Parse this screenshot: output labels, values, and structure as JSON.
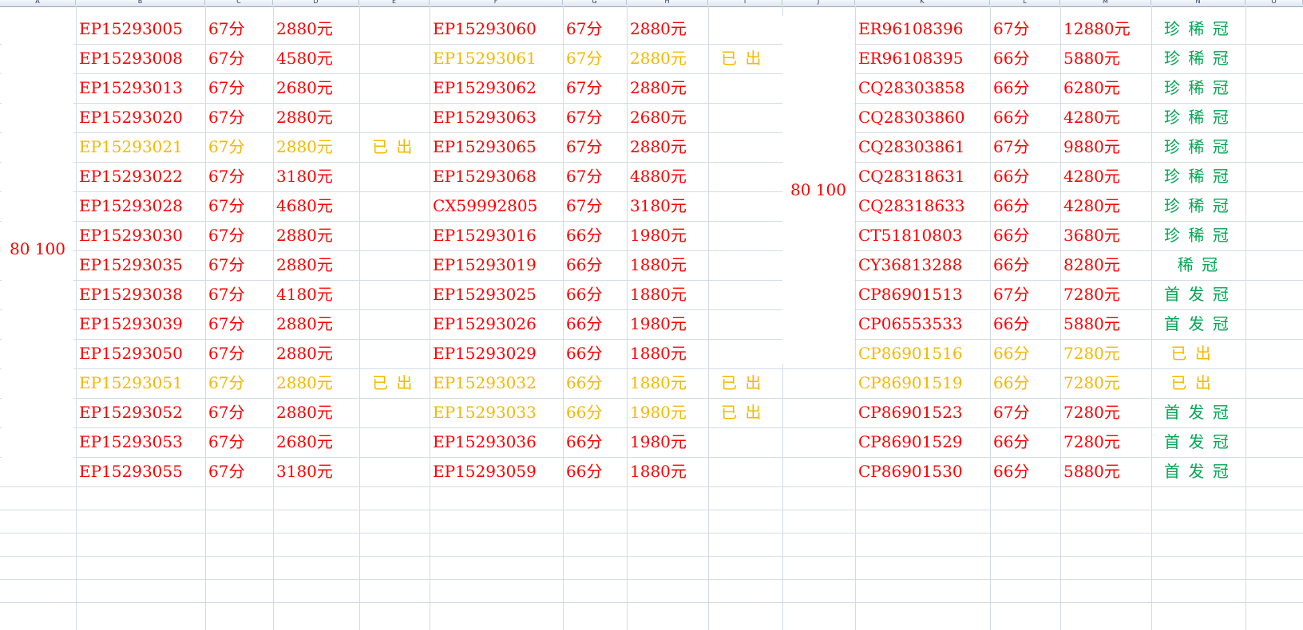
{
  "colors": {
    "red": "#ff0000",
    "gold": "#f5b800",
    "green": "#00a651"
  },
  "columns": [
    "A",
    "B",
    "C",
    "D",
    "E",
    "F",
    "G",
    "H",
    "I",
    "J",
    "K",
    "L",
    "M",
    "N",
    "O"
  ],
  "merged": {
    "left": "80  100",
    "mid": "80  100"
  },
  "blocks": [
    {
      "name": "block-1",
      "rows": [
        {
          "code": "EP15293005",
          "score": "67分",
          "price": "2880元",
          "note": "",
          "c": "red"
        },
        {
          "code": "EP15293008",
          "score": "67分",
          "price": "4580元",
          "note": "",
          "c": "red"
        },
        {
          "code": "EP15293013",
          "score": "67分",
          "price": "2680元",
          "note": "",
          "c": "red"
        },
        {
          "code": "EP15293020",
          "score": "67分",
          "price": "2880元",
          "note": "",
          "c": "red"
        },
        {
          "code": "EP15293021",
          "score": "67分",
          "price": "2880元",
          "note": "已 出",
          "c": "gold"
        },
        {
          "code": "EP15293022",
          "score": "67分",
          "price": "3180元",
          "note": "",
          "c": "red"
        },
        {
          "code": "EP15293028",
          "score": "67分",
          "price": "4680元",
          "note": "",
          "c": "red"
        },
        {
          "code": "EP15293030",
          "score": "67分",
          "price": "2880元",
          "note": "",
          "c": "red"
        },
        {
          "code": "EP15293035",
          "score": "67分",
          "price": "2880元",
          "note": "",
          "c": "red"
        },
        {
          "code": "EP15293038",
          "score": "67分",
          "price": "4180元",
          "note": "",
          "c": "red"
        },
        {
          "code": "EP15293039",
          "score": "67分",
          "price": "2880元",
          "note": "",
          "c": "red"
        },
        {
          "code": "EP15293050",
          "score": "67分",
          "price": "2880元",
          "note": "",
          "c": "red"
        },
        {
          "code": "EP15293051",
          "score": "67分",
          "price": "2880元",
          "note": "已 出",
          "c": "gold"
        },
        {
          "code": "EP15293052",
          "score": "67分",
          "price": "2880元",
          "note": "",
          "c": "red"
        },
        {
          "code": "EP15293053",
          "score": "67分",
          "price": "2680元",
          "note": "",
          "c": "red"
        },
        {
          "code": "EP15293055",
          "score": "67分",
          "price": "3180元",
          "note": "",
          "c": "red"
        }
      ]
    },
    {
      "name": "block-2",
      "rows": [
        {
          "code": "EP15293060",
          "score": "67分",
          "price": "2880元",
          "note": "",
          "c": "red"
        },
        {
          "code": "EP15293061",
          "score": "67分",
          "price": "2880元",
          "note": "已 出",
          "c": "gold"
        },
        {
          "code": "EP15293062",
          "score": "67分",
          "price": "2880元",
          "note": "",
          "c": "red"
        },
        {
          "code": "EP15293063",
          "score": "67分",
          "price": "2680元",
          "note": "",
          "c": "red"
        },
        {
          "code": "EP15293065",
          "score": "67分",
          "price": "2880元",
          "note": "",
          "c": "red"
        },
        {
          "code": "EP15293068",
          "score": "67分",
          "price": "4880元",
          "note": "",
          "c": "red"
        },
        {
          "code": "CX59992805",
          "score": "67分",
          "price": "3180元",
          "note": "",
          "c": "red"
        },
        {
          "code": "EP15293016",
          "score": "66分",
          "price": "1980元",
          "note": "",
          "c": "red"
        },
        {
          "code": "EP15293019",
          "score": "66分",
          "price": "1880元",
          "note": "",
          "c": "red"
        },
        {
          "code": "EP15293025",
          "score": "66分",
          "price": "1880元",
          "note": "",
          "c": "red"
        },
        {
          "code": "EP15293026",
          "score": "66分",
          "price": "1980元",
          "note": "",
          "c": "red"
        },
        {
          "code": "EP15293029",
          "score": "66分",
          "price": "1880元",
          "note": "",
          "c": "red"
        },
        {
          "code": "EP15293032",
          "score": "66分",
          "price": "1880元",
          "note": "已 出",
          "c": "gold"
        },
        {
          "code": "EP15293033",
          "score": "66分",
          "price": "1980元",
          "note": "已 出",
          "c": "gold"
        },
        {
          "code": "EP15293036",
          "score": "66分",
          "price": "1980元",
          "note": "",
          "c": "red"
        },
        {
          "code": "EP15293059",
          "score": "66分",
          "price": "1880元",
          "note": "",
          "c": "red"
        }
      ]
    },
    {
      "name": "block-3",
      "rows": [
        {
          "code": "ER96108396",
          "score": "67分",
          "price": "12880元",
          "note": "珍 稀 冠",
          "c": "red",
          "nc": "green"
        },
        {
          "code": "ER96108395",
          "score": "66分",
          "price": "5880元",
          "note": "珍 稀 冠",
          "c": "red",
          "nc": "green"
        },
        {
          "code": "CQ28303858",
          "score": "66分",
          "price": "6280元",
          "note": "珍 稀 冠",
          "c": "red",
          "nc": "green"
        },
        {
          "code": "CQ28303860",
          "score": "66分",
          "price": "4280元",
          "note": "珍 稀 冠",
          "c": "red",
          "nc": "green"
        },
        {
          "code": "CQ28303861",
          "score": "67分",
          "price": "9880元",
          "note": "珍 稀 冠",
          "c": "red",
          "nc": "green"
        },
        {
          "code": "CQ28318631",
          "score": "66分",
          "price": "4280元",
          "note": "珍 稀 冠",
          "c": "red",
          "nc": "green"
        },
        {
          "code": "CQ28318633",
          "score": "66分",
          "price": "4280元",
          "note": "珍 稀 冠",
          "c": "red",
          "nc": "green"
        },
        {
          "code": "CT51810803",
          "score": "66分",
          "price": "3680元",
          "note": "珍 稀 冠",
          "c": "red",
          "nc": "green"
        },
        {
          "code": "CY36813288",
          "score": "66分",
          "price": "8280元",
          "note": "  稀 冠",
          "c": "red",
          "nc": "green"
        },
        {
          "code": "CP86901513",
          "score": "67分",
          "price": "7280元",
          "note": "首 发 冠",
          "c": "red",
          "nc": "green"
        },
        {
          "code": "CP06553533",
          "score": "66分",
          "price": "5880元",
          "note": "首 发 冠",
          "c": "red",
          "nc": "green"
        },
        {
          "code": "CP86901516",
          "score": "66分",
          "price": "7280元",
          "note": " 已 出",
          "c": "gold",
          "nc": "gold"
        },
        {
          "code": "CP86901519",
          "score": "66分",
          "price": "7280元",
          "note": " 已 出",
          "c": "gold",
          "nc": "gold"
        },
        {
          "code": "CP86901523",
          "score": "67分",
          "price": "7280元",
          "note": "首 发 冠",
          "c": "red",
          "nc": "green"
        },
        {
          "code": "CP86901529",
          "score": "66分",
          "price": "7280元",
          "note": "首 发 冠",
          "c": "red",
          "nc": "green"
        },
        {
          "code": "CP86901530",
          "score": "66分",
          "price": "5880元",
          "note": "首 发 冠",
          "c": "red",
          "nc": "green"
        }
      ]
    }
  ]
}
